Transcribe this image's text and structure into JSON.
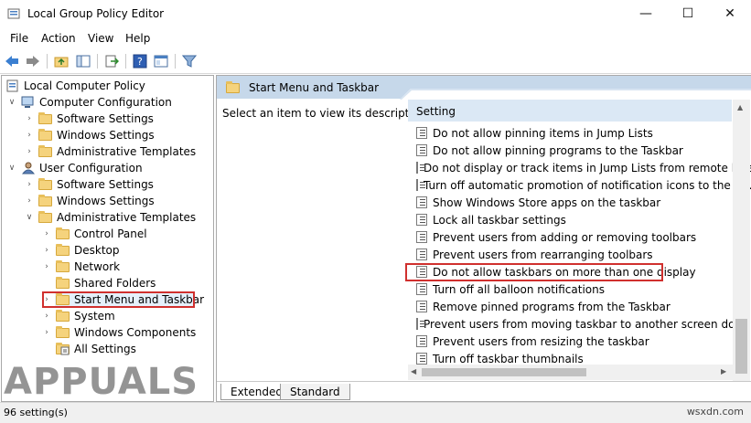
{
  "window": {
    "title": "Local Group Policy Editor",
    "minimize": "—",
    "maximize": "☐",
    "close": "✕"
  },
  "menu": [
    "File",
    "Action",
    "View",
    "Help"
  ],
  "toolbar_icons": [
    "back-arrow-icon",
    "forward-arrow-icon",
    "up-folder-icon",
    "show-hide-tree-icon",
    "export-list-icon",
    "help-icon",
    "properties-icon",
    "filter-icon"
  ],
  "tree": {
    "root": "Local Computer Policy",
    "items": [
      {
        "label": "Computer Configuration"
      },
      {
        "label": "Software Settings"
      },
      {
        "label": "Windows Settings"
      },
      {
        "label": "Administrative Templates"
      },
      {
        "label": "User Configuration"
      },
      {
        "label": "Software Settings"
      },
      {
        "label": "Windows Settings"
      },
      {
        "label": "Administrative Templates"
      },
      {
        "label": "Control Panel"
      },
      {
        "label": "Desktop"
      },
      {
        "label": "Network"
      },
      {
        "label": "Shared Folders"
      },
      {
        "label": "Start Menu and Taskbar"
      },
      {
        "label": "System"
      },
      {
        "label": "Windows Components"
      },
      {
        "label": "All Settings"
      }
    ]
  },
  "details": {
    "header": "Start Menu and Taskbar",
    "description": "Select an item to view its description.",
    "column": "Setting",
    "rows": [
      "Do not allow pinning items in Jump Lists",
      "Do not allow pinning programs to the Taskbar",
      "Do not display or track items in Jump Lists from remote loca...",
      "Turn off automatic promotion of notification icons to the ta...",
      "Show Windows Store apps on the taskbar",
      "Lock all taskbar settings",
      "Prevent users from adding or removing toolbars",
      "Prevent users from rearranging toolbars",
      "Do not allow taskbars on more than one display",
      "Turn off all balloon notifications",
      "Remove pinned programs from the Taskbar",
      "Prevent users from moving taskbar to another screen dock l...",
      "Prevent users from resizing the taskbar",
      "Turn off taskbar thumbnails"
    ],
    "tabs": [
      "Extended",
      "Standard"
    ]
  },
  "status": "96 setting(s)",
  "watermark": "APPUALS",
  "site": "wsxdn.com"
}
